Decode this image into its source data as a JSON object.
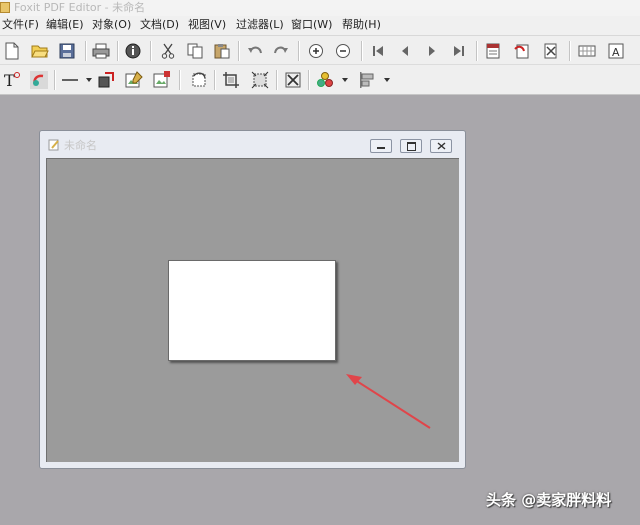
{
  "app": {
    "window_title": "Foxit PDF Editor - 未命名"
  },
  "menu": {
    "items": [
      {
        "label": "文件(F)"
      },
      {
        "label": "编辑(E)"
      },
      {
        "label": "对象(O)"
      },
      {
        "label": "文档(D)"
      },
      {
        "label": "视图(V)"
      },
      {
        "label": "过滤器(L)"
      },
      {
        "label": "窗口(W)"
      },
      {
        "label": "帮助(H)"
      }
    ]
  },
  "toolbar1": {
    "icons": [
      "new-document-icon",
      "open-folder-icon",
      "save-icon",
      "print-icon",
      "info-icon",
      "cut-icon",
      "copy-icon",
      "paste-icon",
      "undo-icon",
      "redo-icon",
      "zoom-in-icon",
      "zoom-out-icon",
      "first-page-icon",
      "previous-page-icon",
      "next-page-icon",
      "last-page-icon",
      "page-properties-icon",
      "insert-page-icon",
      "delete-page-icon",
      "grid-icon",
      "text-tool-icon"
    ]
  },
  "toolbar2": {
    "icons": [
      "text-object-icon",
      "shading-icon",
      "line-icon",
      "shape-icon",
      "edit-image-icon",
      "new-image-icon",
      "rotate-icon",
      "crop-icon",
      "transform-icon",
      "delete-object-icon",
      "color-icon",
      "align-icon"
    ]
  },
  "document_window": {
    "title": "未命名",
    "buttons": [
      "minimize",
      "restore",
      "close"
    ]
  },
  "watermark": {
    "text": "头条 @卖家胖料料"
  }
}
